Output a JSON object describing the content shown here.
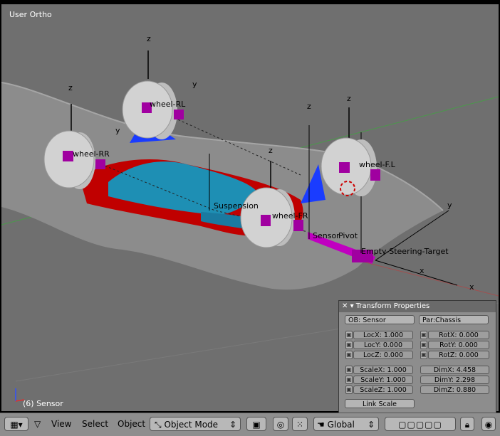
{
  "viewport": {
    "view_name": "User Ortho",
    "status": "(6) Sensor",
    "labels": {
      "wheel_rl": "wheel-RL",
      "wheel_rr": "wheel-RR",
      "wheel_fl": "wheel-F.L",
      "wheel_fr": "wheel-FR",
      "suspension": "Suspension",
      "sensor": "Sensor",
      "pivot": "Pivot",
      "empty_target": "Empty-Steering-Target"
    },
    "axes": {
      "x": "x",
      "y": "y",
      "z": "z"
    }
  },
  "transform_panel": {
    "title": "Transform Properties",
    "ob": "OB: Sensor",
    "par": "Par:Chassis",
    "loc": [
      "LocX: 1.000",
      "LocY: 0.000",
      "LocZ: 0.000"
    ],
    "rot": [
      "RotX: 0.000",
      "RotY: 0.000",
      "RotZ: 0.000"
    ],
    "scale": [
      "ScaleX: 1.000",
      "ScaleY: 1.000",
      "ScaleZ: 1.000"
    ],
    "dim": [
      "DimX: 4.458",
      "DimY: 2.298",
      "DimZ: 0.880"
    ],
    "link_scale": "Link Scale"
  },
  "header": {
    "menus": [
      "View",
      "Select",
      "Object"
    ],
    "mode": "Object Mode",
    "orientation": "Global"
  },
  "colors": {
    "viewport_bg": "#6f6f6f",
    "terrain": "#8c8c8c",
    "chassis_red": "#c00000",
    "chassis_blue": "#1e8fb4",
    "wheel": "#cfcfcf",
    "marker": "#a000a0",
    "panel": "#8d8d8d",
    "header": "#8e8e8e"
  }
}
